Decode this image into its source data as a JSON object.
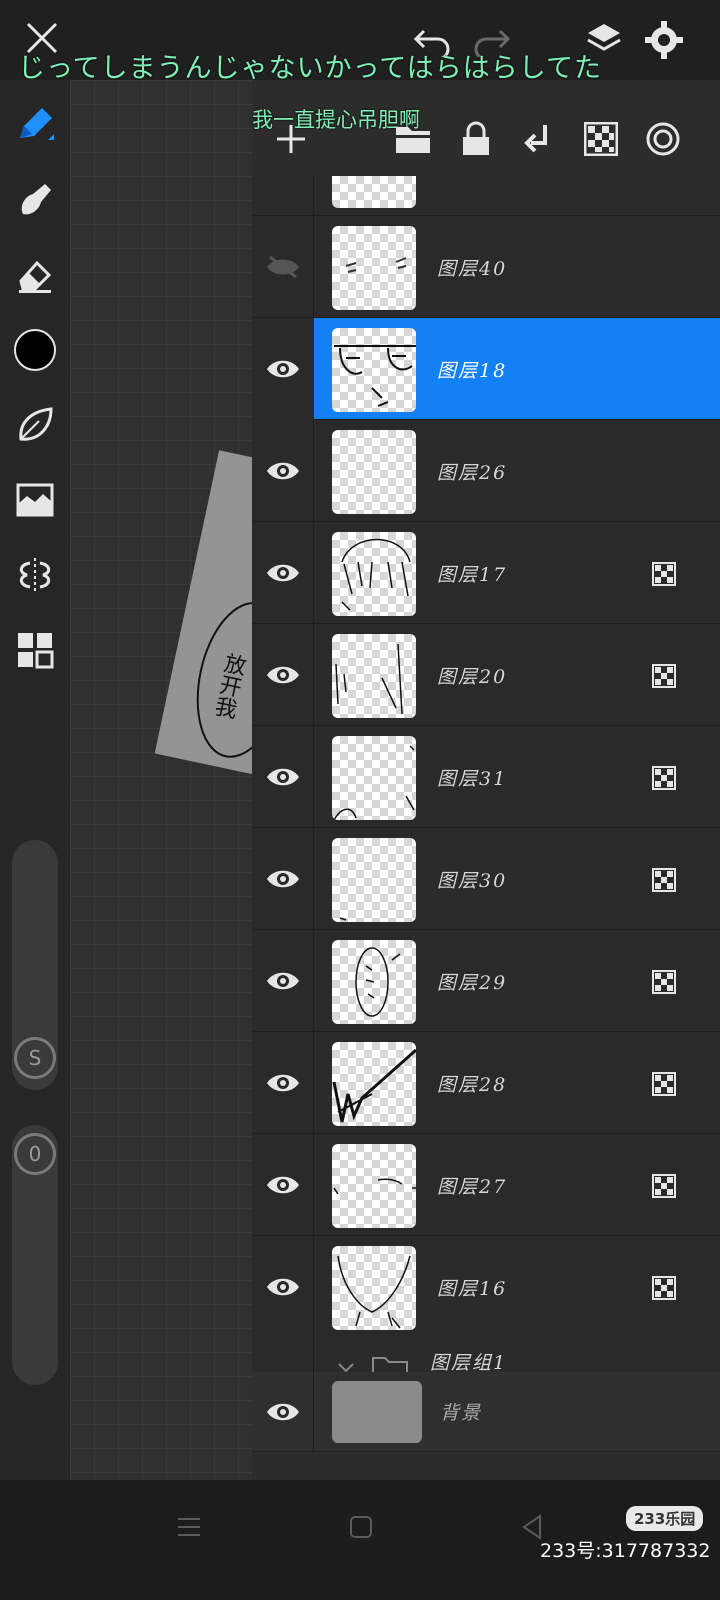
{
  "lyrics": {
    "line1": "じってしまうんじゃないかってはらはらしてた",
    "line2": "我一直提心吊胆啊"
  },
  "canvas": {
    "sketch_text": "放开我"
  },
  "layers": [
    {
      "name": "图层40",
      "visible": false,
      "selected": false,
      "mask": false
    },
    {
      "name": "图层18",
      "visible": true,
      "selected": true,
      "mask": false
    },
    {
      "name": "图层26",
      "visible": true,
      "selected": false,
      "mask": false
    },
    {
      "name": "图层17",
      "visible": true,
      "selected": false,
      "mask": true
    },
    {
      "name": "图层20",
      "visible": true,
      "selected": false,
      "mask": true
    },
    {
      "name": "图层31",
      "visible": true,
      "selected": false,
      "mask": true
    },
    {
      "name": "图层30",
      "visible": true,
      "selected": false,
      "mask": true
    },
    {
      "name": "图层29",
      "visible": true,
      "selected": false,
      "mask": true
    },
    {
      "name": "图层28",
      "visible": true,
      "selected": false,
      "mask": true
    },
    {
      "name": "图层27",
      "visible": true,
      "selected": false,
      "mask": true
    },
    {
      "name": "图层16",
      "visible": true,
      "selected": false,
      "mask": true
    }
  ],
  "layer_group": {
    "name": "图层组1"
  },
  "background_layer": {
    "name": "背景"
  },
  "sliders": {
    "size_label": "S",
    "opacity_label": "0"
  },
  "watermark": {
    "badge": "233乐园",
    "id": "233号:317787332"
  },
  "colors": {
    "accent": "#1480f5",
    "lyric": "#7ef0b6",
    "current_color": "#000000"
  }
}
